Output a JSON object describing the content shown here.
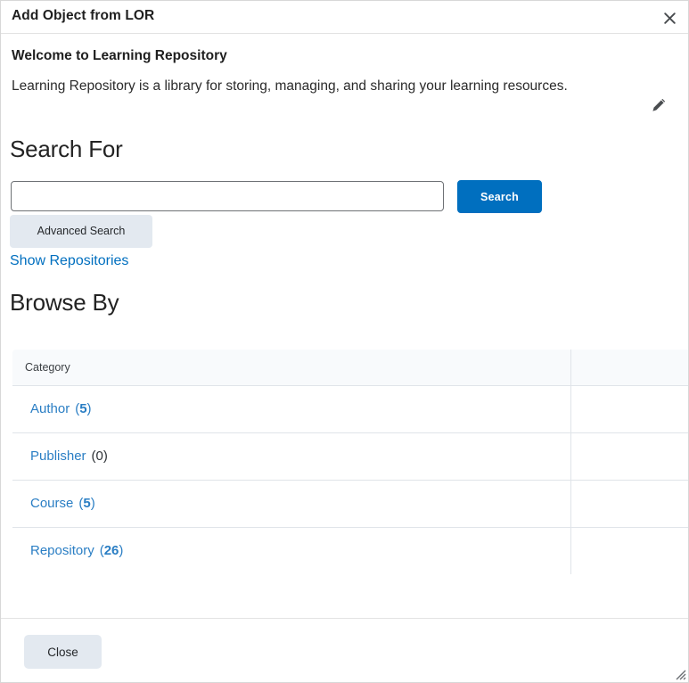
{
  "dialog": {
    "title": "Add Object from LOR",
    "close_icon": "close-icon"
  },
  "welcome": {
    "heading": "Welcome to Learning Repository",
    "description": "Learning Repository is a library for storing, managing, and sharing your learning resources.",
    "edit_icon": "pencil-icon"
  },
  "search": {
    "heading": "Search For",
    "input_value": "",
    "input_placeholder": "",
    "search_button": "Search",
    "advanced_search_button": "Advanced Search",
    "show_repositories_link": "Show Repositories"
  },
  "browse": {
    "heading": "Browse By",
    "columns": [
      "Category",
      ""
    ],
    "rows": [
      {
        "label": "Author",
        "count": "5",
        "count_open": "(",
        "count_close": ")",
        "zero": false
      },
      {
        "label": "Publisher",
        "count": "0",
        "count_open": "(",
        "count_close": ")",
        "zero": true
      },
      {
        "label": "Course",
        "count": "5",
        "count_open": "(",
        "count_close": ")",
        "zero": false
      },
      {
        "label": "Repository",
        "count": "26",
        "count_open": "(",
        "count_close": ")",
        "zero": false
      }
    ]
  },
  "footer": {
    "close_button": "Close",
    "resize_grip_icon": "resize-grip-icon"
  },
  "colors": {
    "link": "#2a7ec4",
    "primary_button": "#006fbf",
    "secondary_button": "#e3e9f0",
    "table_border": "#e0e4e9",
    "table_header_bg": "#f8fafc"
  }
}
